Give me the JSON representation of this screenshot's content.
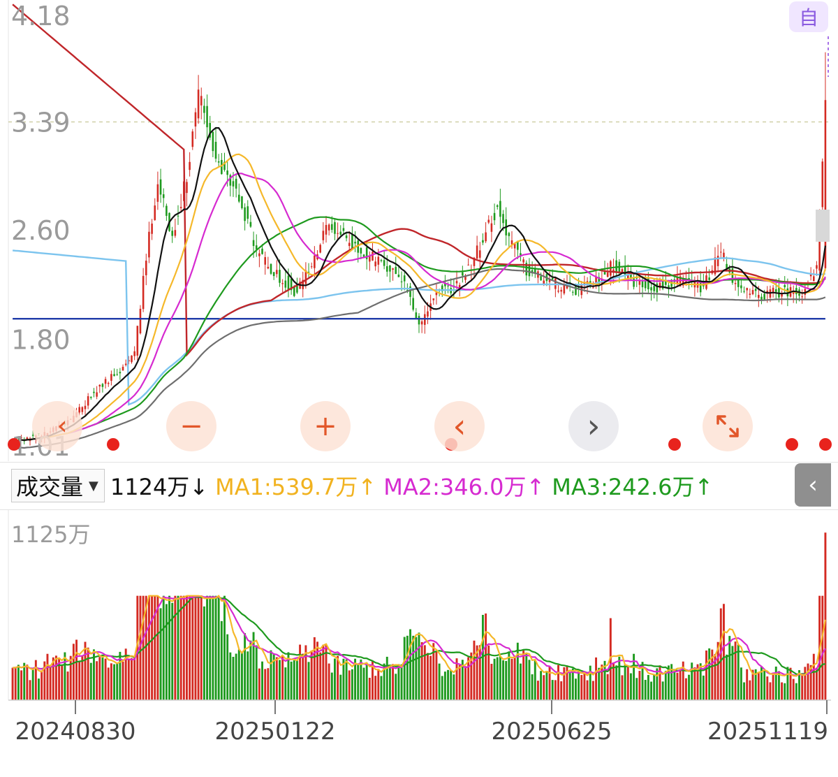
{
  "price_panel": {
    "y_labels": [
      "4.18",
      "3.39",
      "2.60",
      "1.80",
      "1.01"
    ],
    "ref_line_price": 3.39
  },
  "badge": {
    "zi_label": "自"
  },
  "controls": {
    "rewind_icon": "double-chevron-left-icon",
    "zoom_out_label": "−",
    "zoom_in_label": "+",
    "prev_label": "‹",
    "next_label": "›",
    "fullscreen_icon": "expand-arrows-icon"
  },
  "volume_header": {
    "selector_label": "成交量",
    "current": "1124万",
    "current_arrow": "↓",
    "ma1": "MA1:539.7万",
    "ma1_arrow": "↑",
    "ma2": "MA2:346.0万",
    "ma2_arrow": "↑",
    "ma3": "MA3:242.6万",
    "ma3_arrow": "↑",
    "collapse_icon": "chevron-left-icon"
  },
  "volume_panel": {
    "max_label": "1125万"
  },
  "x_axis": {
    "labels": [
      "20240830",
      "20250122",
      "20250625",
      "20251119"
    ]
  },
  "colors": {
    "up": "#d42a22",
    "down": "#1e9a1e",
    "ma_black": "#111111",
    "ma_yellow": "#f5b82a",
    "ma_magenta": "#d62ad0",
    "ma_green": "#1e9a1e",
    "ma_red": "#c0262a",
    "ma_gray": "#6e6e6e",
    "ma_lightblue": "#7cc4ee",
    "ma_navy": "#1e3aa8"
  },
  "chart_data": {
    "type": "candlestick",
    "ylim": [
      1.01,
      4.18
    ],
    "price_anchors": [
      {
        "i": 0,
        "c": 1.05
      },
      {
        "i": 10,
        "c": 1.1
      },
      {
        "i": 20,
        "c": 1.22
      },
      {
        "i": 30,
        "c": 1.45
      },
      {
        "i": 36,
        "c": 1.55
      },
      {
        "i": 42,
        "c": 1.7
      },
      {
        "i": 46,
        "c": 2.4
      },
      {
        "i": 50,
        "c": 2.95
      },
      {
        "i": 55,
        "c": 2.55
      },
      {
        "i": 60,
        "c": 3.0
      },
      {
        "i": 64,
        "c": 3.6
      },
      {
        "i": 68,
        "c": 3.3
      },
      {
        "i": 72,
        "c": 3.05
      },
      {
        "i": 78,
        "c": 2.85
      },
      {
        "i": 84,
        "c": 2.45
      },
      {
        "i": 90,
        "c": 2.3
      },
      {
        "i": 97,
        "c": 2.15
      },
      {
        "i": 103,
        "c": 2.35
      },
      {
        "i": 108,
        "c": 2.65
      },
      {
        "i": 114,
        "c": 2.55
      },
      {
        "i": 120,
        "c": 2.45
      },
      {
        "i": 127,
        "c": 2.35
      },
      {
        "i": 134,
        "c": 2.25
      },
      {
        "i": 140,
        "c": 1.9
      },
      {
        "i": 146,
        "c": 2.15
      },
      {
        "i": 152,
        "c": 2.18
      },
      {
        "i": 158,
        "c": 2.35
      },
      {
        "i": 163,
        "c": 2.6
      },
      {
        "i": 167,
        "c": 2.75
      },
      {
        "i": 171,
        "c": 2.55
      },
      {
        "i": 177,
        "c": 2.3
      },
      {
        "i": 185,
        "c": 2.22
      },
      {
        "i": 193,
        "c": 2.15
      },
      {
        "i": 200,
        "c": 2.2
      },
      {
        "i": 207,
        "c": 2.35
      },
      {
        "i": 214,
        "c": 2.22
      },
      {
        "i": 222,
        "c": 2.18
      },
      {
        "i": 230,
        "c": 2.22
      },
      {
        "i": 238,
        "c": 2.18
      },
      {
        "i": 244,
        "c": 2.45
      },
      {
        "i": 250,
        "c": 2.15
      },
      {
        "i": 258,
        "c": 2.12
      },
      {
        "i": 265,
        "c": 2.15
      },
      {
        "i": 272,
        "c": 2.15
      },
      {
        "i": 277,
        "c": 2.3
      },
      {
        "i": 280,
        "c": 3.55
      }
    ],
    "candle_count": 281,
    "volume": {
      "unit": "万",
      "ylim": [
        0,
        1125
      ],
      "last": 1124,
      "ma1": 539.7,
      "ma2": 346.0,
      "ma3": 242.6
    },
    "x_labels": [
      "20240830",
      "20250122",
      "20250625",
      "20251119"
    ],
    "signal_marker_count": 6
  }
}
